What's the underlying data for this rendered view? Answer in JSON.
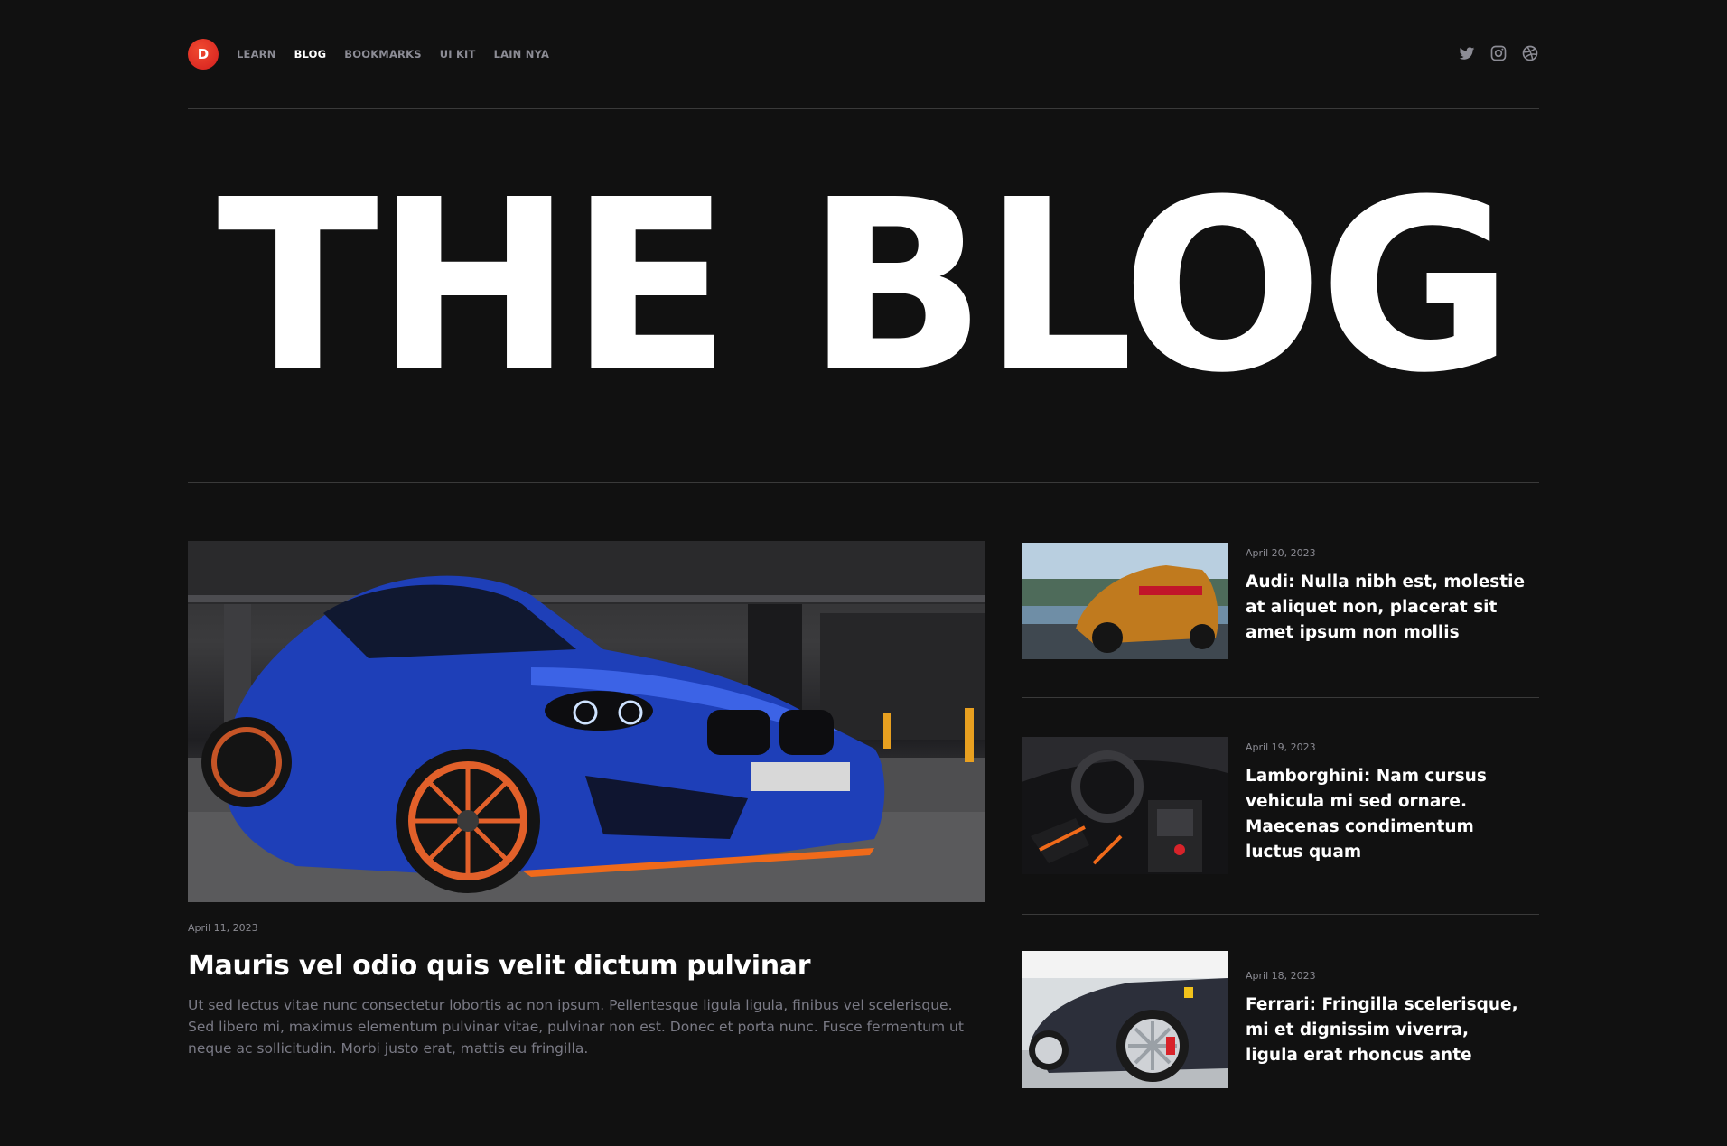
{
  "brand": {
    "logo_letter": "D",
    "accent": "#e3261f"
  },
  "nav": {
    "items": [
      {
        "label": "LEARN",
        "active": false
      },
      {
        "label": "BLOG",
        "active": true
      },
      {
        "label": "BOOKMARKS",
        "active": false
      },
      {
        "label": "UI KIT",
        "active": false
      },
      {
        "label": "LAIN NYA",
        "active": false
      }
    ]
  },
  "social": {
    "icons": [
      "twitter-icon",
      "instagram-icon",
      "dribbble-icon"
    ]
  },
  "hero": {
    "title": "THE BLOG"
  },
  "featured": {
    "date": "April 11, 2023",
    "title": "Mauris vel odio quis velit dictum pulvinar",
    "excerpt": "Ut sed lectus vitae nunc consectetur lobortis ac non ipsum. Pellentesque ligula ligula, finibus vel scelerisque. Sed libero mi, maximus elementum pulvinar vitae, pulvinar non est. Donec et porta nunc. Fusce fermentum ut neque ac sollicitudin. Morbi justo erat, mattis eu fringilla."
  },
  "side_posts": [
    {
      "date": "April 20, 2023",
      "title": "Audi: Nulla nibh est, molestie at aliquet non, placerat sit amet ipsum non mollis"
    },
    {
      "date": "April 19, 2023",
      "title": "Lamborghini: Nam cursus vehicula mi sed ornare. Maecenas condimentum luctus quam"
    },
    {
      "date": "April 18, 2023",
      "title": "Ferrari: Fringilla scelerisque, mi et dignissim viverra, ligula erat rhoncus ante"
    }
  ]
}
